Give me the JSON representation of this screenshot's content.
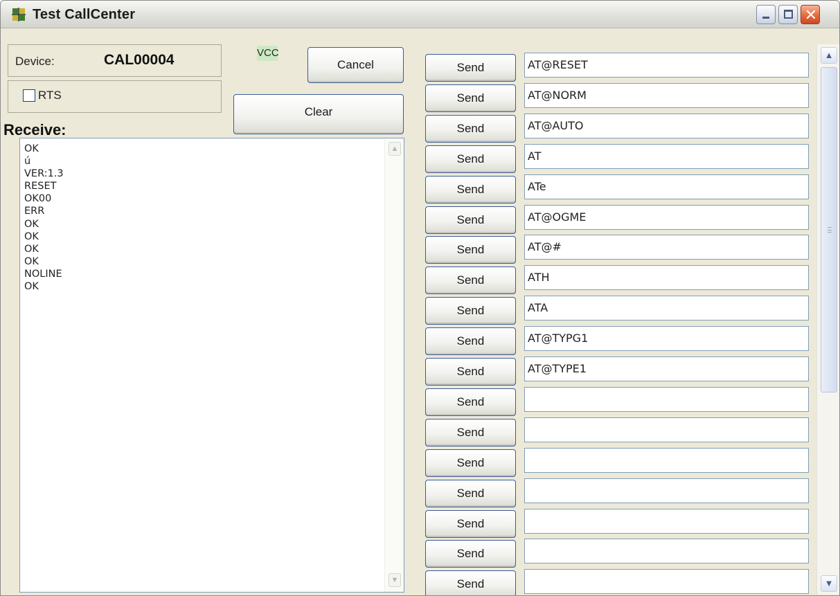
{
  "window": {
    "title": "Test CallCenter",
    "close_glyph": "✕",
    "icons": {
      "app": "app-icon",
      "minimize": "minimize-icon",
      "maximize": "maximize-icon",
      "close": "close-icon"
    }
  },
  "device": {
    "label": "Device:",
    "value": "CAL00004"
  },
  "rts": {
    "label": "RTS",
    "checked": false
  },
  "vcc": {
    "label": "VCC",
    "color": "#cfe8c4"
  },
  "buttons": {
    "cancel": "Cancel",
    "clear": "Clear"
  },
  "receive": {
    "label": "Receive:",
    "lines": [
      "OK",
      "ú",
      "VER:1.3",
      "RESET",
      "OK00",
      "ERR",
      "OK",
      "OK",
      "OK",
      "OK",
      "NOLINE",
      "OK"
    ]
  },
  "commands": [
    {
      "button": "Send",
      "value": "AT@RESET"
    },
    {
      "button": "Send",
      "value": "AT@NORM"
    },
    {
      "button": "Send",
      "value": "AT@AUTO"
    },
    {
      "button": "Send",
      "value": "AT"
    },
    {
      "button": "Send",
      "value": "ATe"
    },
    {
      "button": "Send",
      "value": "AT@OGME"
    },
    {
      "button": "Send",
      "value": "AT@#"
    },
    {
      "button": "Send",
      "value": "ATH"
    },
    {
      "button": "Send",
      "value": "ATA"
    },
    {
      "button": "Send",
      "value": "AT@TYPG1"
    },
    {
      "button": "Send",
      "value": "AT@TYPE1"
    },
    {
      "button": "Send",
      "value": ""
    },
    {
      "button": "Send",
      "value": ""
    },
    {
      "button": "Send",
      "value": ""
    },
    {
      "button": "Send",
      "value": ""
    },
    {
      "button": "Send",
      "value": ""
    },
    {
      "button": "Send",
      "value": ""
    },
    {
      "button": "Send",
      "value": ""
    }
  ],
  "scrollbar": {
    "up_glyph": "▲",
    "down_glyph": "▼"
  }
}
